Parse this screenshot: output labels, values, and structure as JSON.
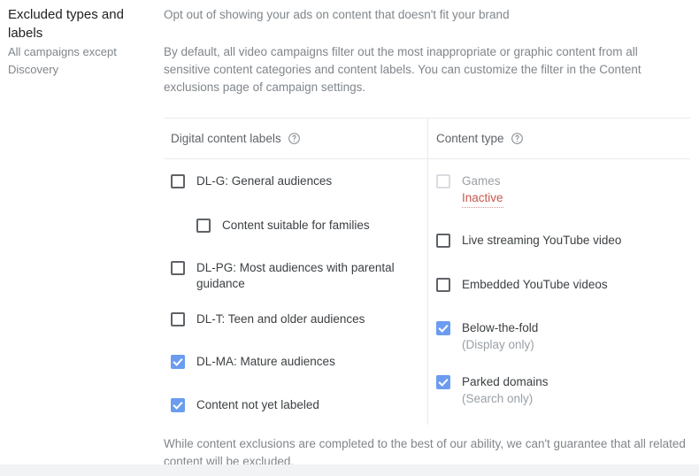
{
  "sidebar": {
    "title": "Excluded types and labels",
    "subtitle": "All campaigns except Discovery"
  },
  "main": {
    "lead_text": "Opt out of showing your ads on content that doesn't fit your brand",
    "body_text": "By default, all video campaigns filter out the most inappropriate or graphic content from all sensitive content categories and content labels. You can customize the filter in the Content exclusions page of campaign settings.",
    "footnote": "While content exclusions are completed to the best of our ability, we can't guarantee that all related content will be excluded."
  },
  "table": {
    "columns": [
      {
        "header": "Digital content labels",
        "help_icon": "help-circle-icon"
      },
      {
        "header": "Content type",
        "help_icon": "help-circle-icon"
      }
    ],
    "digital_content_labels": [
      {
        "label": "DL-G: General audiences",
        "checked": false,
        "indented": false,
        "disabled": false
      },
      {
        "label": "Content suitable for families",
        "checked": false,
        "indented": true,
        "disabled": false
      },
      {
        "label": "DL-PG: Most audiences with parental guidance",
        "checked": false,
        "indented": false,
        "disabled": false
      },
      {
        "label": "DL-T: Teen and older audiences",
        "checked": false,
        "indented": false,
        "disabled": false
      },
      {
        "label": "DL-MA: Mature audiences",
        "checked": true,
        "indented": false,
        "disabled": false
      },
      {
        "label": "Content not yet labeled",
        "checked": true,
        "indented": false,
        "disabled": false
      }
    ],
    "content_types": [
      {
        "label": "Games",
        "checked": false,
        "disabled": true,
        "status": "Inactive",
        "sublabel": ""
      },
      {
        "label": "Live streaming YouTube video",
        "checked": false,
        "disabled": false,
        "status": "",
        "sublabel": ""
      },
      {
        "label": "Embedded YouTube videos",
        "checked": false,
        "disabled": false,
        "status": "",
        "sublabel": ""
      },
      {
        "label": "Below-the-fold",
        "checked": true,
        "disabled": false,
        "status": "",
        "sublabel": "(Display only)"
      },
      {
        "label": "Parked domains",
        "checked": true,
        "disabled": false,
        "status": "",
        "sublabel": "(Search only)"
      }
    ]
  },
  "colors": {
    "checkbox_checked": "#6b9cf0",
    "checkbox_border": "#5f6368",
    "status_inactive": "#c5584f",
    "text_primary": "#3c4043",
    "text_secondary": "#80868b",
    "divider": "#e8eaed",
    "bottom_bar": "#f1f3f4"
  }
}
